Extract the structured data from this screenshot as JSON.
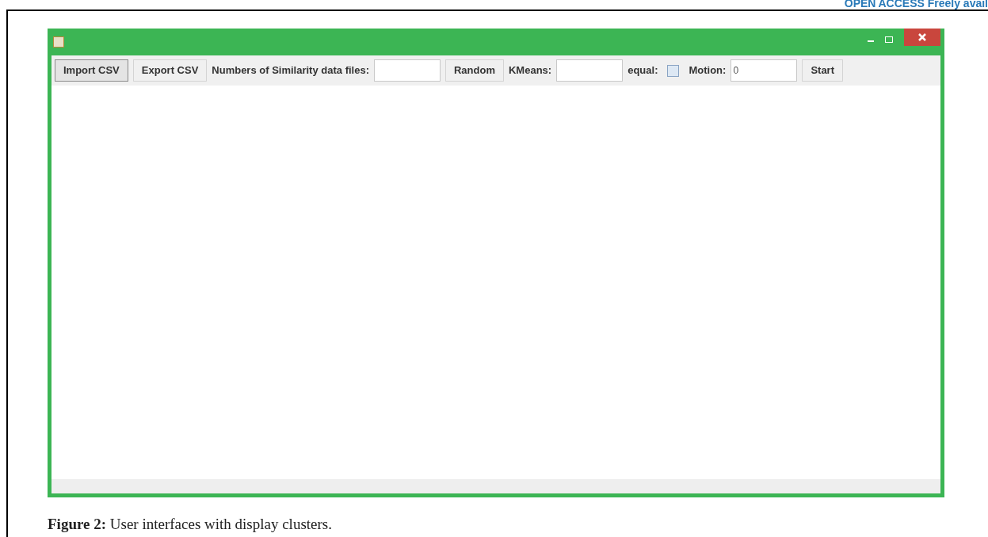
{
  "header": {
    "badge": "OPEN",
    "text": "ACCESS Freely avail"
  },
  "toolbar": [
    {
      "kind": "button",
      "label": "Import CSV",
      "selected": true
    },
    {
      "kind": "button",
      "label": "Export CSV",
      "selected": false
    },
    {
      "kind": "label",
      "label": "Numbers of Similarity data files:"
    },
    {
      "kind": "field"
    },
    {
      "kind": "button",
      "label": "Random",
      "selected": false
    },
    {
      "kind": "label",
      "label": "KMeans:"
    },
    {
      "kind": "field"
    },
    {
      "kind": "label",
      "label": "equal:"
    },
    {
      "kind": "checkbox",
      "checked": false
    },
    {
      "kind": "label",
      "label": "Motion:"
    },
    {
      "kind": "field",
      "value": "0"
    },
    {
      "kind": "button",
      "label": "Start",
      "selected": false
    }
  ],
  "caption": {
    "label": "Figure 2:",
    "text": "User interfaces with display clusters."
  }
}
